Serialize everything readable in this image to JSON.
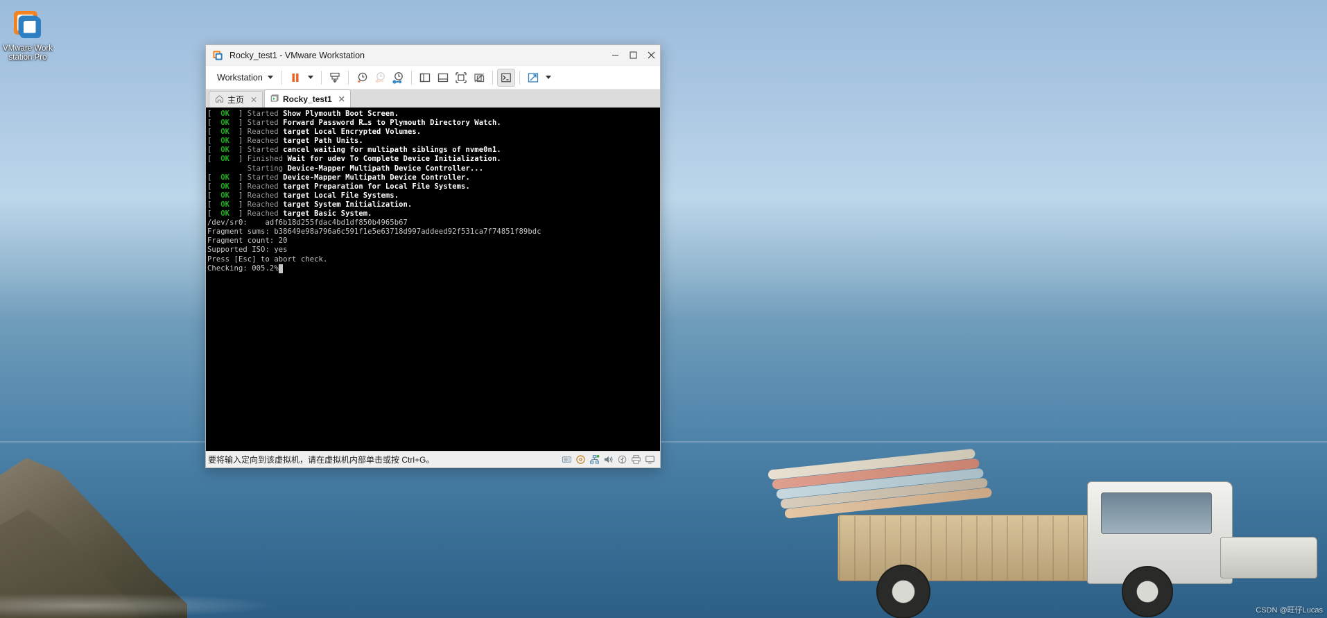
{
  "desktop": {
    "icon": {
      "name": "vmware-workstation-pro-shortcut",
      "label": "VMware Workstation Pro"
    },
    "watermark": "CSDN @旺仔Lucas"
  },
  "window": {
    "title": "Rocky_test1 - VMware Workstation",
    "app_icon": "vmware-logo-icon",
    "controls": {
      "minimize": "–",
      "maximize": "☐",
      "close": "✕"
    }
  },
  "toolbar": {
    "menu_label": "Workstation",
    "buttons": [
      {
        "name": "suspend-button",
        "icon": "pause-icon",
        "state": "normal"
      },
      {
        "name": "power-dropdown-button",
        "icon": "chevron-down-icon",
        "state": "normal"
      },
      {
        "name": "send-ctrl-alt-del-button",
        "icon": "send-key-icon",
        "state": "normal"
      },
      {
        "name": "take-snapshot-button",
        "icon": "clock-plus-icon",
        "state": "normal"
      },
      {
        "name": "revert-snapshot-button",
        "icon": "clock-back-arrow-icon",
        "state": "disabled"
      },
      {
        "name": "manage-snapshots-button",
        "icon": "clock-wrench-icon",
        "state": "normal"
      },
      {
        "name": "show-library-button",
        "icon": "panel-left-icon",
        "state": "normal"
      },
      {
        "name": "show-thumbnail-bar-button",
        "icon": "panel-bottom-icon",
        "state": "normal"
      },
      {
        "name": "full-screen-button",
        "icon": "fullscreen-icon",
        "state": "normal"
      },
      {
        "name": "unity-mode-button",
        "icon": "unity-off-icon",
        "state": "normal"
      },
      {
        "name": "console-view-button",
        "icon": "terminal-prompt-icon",
        "state": "selected"
      },
      {
        "name": "stretch-guest-button",
        "icon": "expand-arrows-icon",
        "state": "normal"
      },
      {
        "name": "stretch-dropdown-button",
        "icon": "chevron-down-icon",
        "state": "normal"
      }
    ]
  },
  "tabs": [
    {
      "name": "tab-home",
      "label": "主页",
      "icon": "home-icon",
      "active": false,
      "closable": true
    },
    {
      "name": "tab-rocky-test1",
      "label": "Rocky_test1",
      "icon": "vm-screen-icon",
      "active": true,
      "closable": true
    }
  ],
  "console": {
    "lines": [
      {
        "type": "status",
        "state": "OK",
        "verb": "Started",
        "msg": "Show Plymouth Boot Screen."
      },
      {
        "type": "status",
        "state": "OK",
        "verb": "Started",
        "msg": "Forward Password R…s to Plymouth Directory Watch."
      },
      {
        "type": "status",
        "state": "OK",
        "verb": "Reached",
        "msg": "target Local Encrypted Volumes."
      },
      {
        "type": "status",
        "state": "OK",
        "verb": "Reached",
        "msg": "target Path Units."
      },
      {
        "type": "status",
        "state": "OK",
        "verb": "Started",
        "msg": "cancel waiting for multipath siblings of nvme0n1."
      },
      {
        "type": "status",
        "state": "OK",
        "verb": "Finished",
        "msg": "Wait for udev To Complete Device Initialization."
      },
      {
        "type": "starting",
        "verb": "Starting",
        "msg": "Device-Mapper Multipath Device Controller..."
      },
      {
        "type": "status",
        "state": "OK",
        "verb": "Started",
        "msg": "Device-Mapper Multipath Device Controller."
      },
      {
        "type": "status",
        "state": "OK",
        "verb": "Reached",
        "msg": "target Preparation for Local File Systems."
      },
      {
        "type": "status",
        "state": "OK",
        "verb": "Reached",
        "msg": "target Local File Systems."
      },
      {
        "type": "status",
        "state": "OK",
        "verb": "Reached",
        "msg": "target System Initialization."
      },
      {
        "type": "status",
        "state": "OK",
        "verb": "Reached",
        "msg": "target Basic System."
      },
      {
        "type": "plain",
        "text": "/dev/sr0:    adf6b18d255fdac4bd1df850b4965b67"
      },
      {
        "type": "plain",
        "text": "Fragment sums: b38649e98a796a6c591f1e5e63718d997addeed92f531ca7f74851f89bdc"
      },
      {
        "type": "plain",
        "text": "Fragment count: 20"
      },
      {
        "type": "plain",
        "text": "Supported ISO: yes"
      },
      {
        "type": "plain",
        "text": "Press [Esc] to abort check."
      },
      {
        "type": "cursor",
        "text": "Checking: 005.2%"
      }
    ]
  },
  "statusbar": {
    "message": "要将输入定向到该虚拟机，请在虚拟机内部单击或按 Ctrl+G。",
    "icons": [
      {
        "name": "status-harddisk-icon",
        "glyph": "hdd"
      },
      {
        "name": "status-cdrom-icon",
        "glyph": "cd"
      },
      {
        "name": "status-network-icon",
        "glyph": "net"
      },
      {
        "name": "status-sound-icon",
        "glyph": "snd"
      },
      {
        "name": "status-usb-icon",
        "glyph": "usb"
      },
      {
        "name": "status-printer-icon",
        "glyph": "prn"
      },
      {
        "name": "status-display-icon",
        "glyph": "dsp"
      }
    ]
  },
  "colors": {
    "accent_orange": "#f07020",
    "accent_blue": "#3a8fd0",
    "ok_green": "#18b218",
    "window_chrome": "#f3f3f3",
    "tabstrip": "#dcdcdc"
  }
}
